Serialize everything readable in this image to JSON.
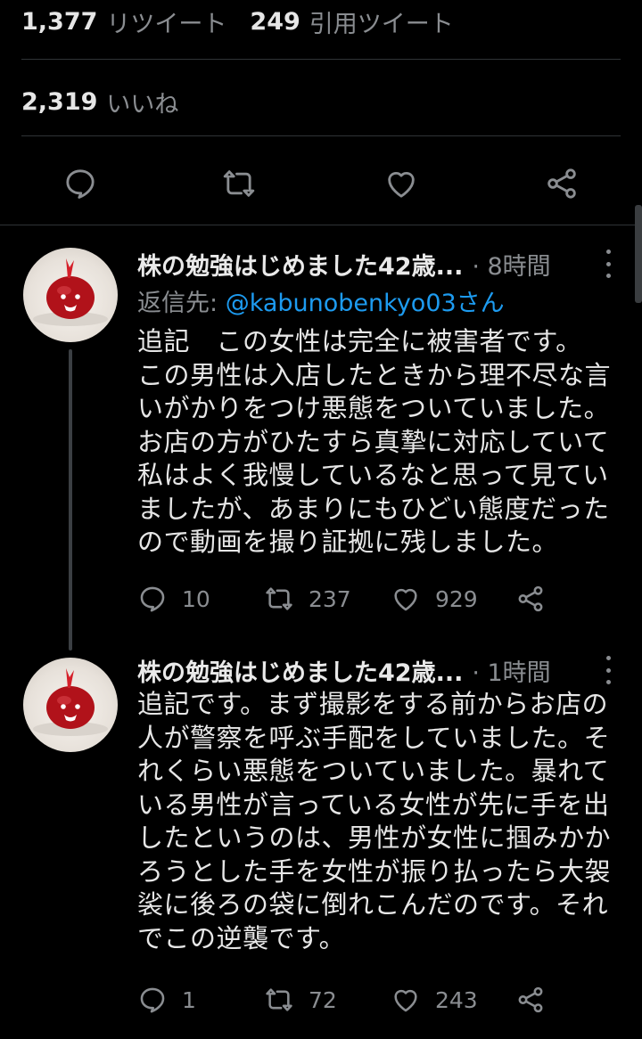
{
  "stats": {
    "retweets_count": "1,377",
    "retweets_label": "リツイート",
    "quotes_count": "249",
    "quotes_label": "引用ツイート",
    "likes_count": "2,319",
    "likes_label": "いいね"
  },
  "action_bar_icons": [
    "reply-icon",
    "retweet-icon",
    "like-icon",
    "share-icon"
  ],
  "tweets": [
    {
      "author": "株の勉強はじめました42歳...",
      "time": "· 8時間",
      "reply_label": "返信先:",
      "reply_handle": "@kabunobenkyo03さん",
      "lines": [
        "追記　この女性は完全に被害者です。",
        "この男性は入店したときから理不尽な言",
        "いがかりをつけ悪態をついていました。",
        "お店の方がひたすら真摯に対応していて",
        "私はよく我慢しているなと思って見てい",
        "ましたが、あまりにもひどい態度だった",
        "ので動画を撮り証拠に残しました。"
      ],
      "replies": "10",
      "retweets": "237",
      "likes": "929"
    },
    {
      "author": "株の勉強はじめました42歳...",
      "time": "· 1時間",
      "lines": [
        "追記です。まず撮影をする前からお店の",
        "人が警察を呼ぶ手配をしていました。そ",
        "れくらい悪態をついていました。暴れて",
        "いる男性が言っている女性が先に手を出",
        "したというのは、男性が女性に掴みかか",
        "ろうとした手を女性が振り払ったら大袈",
        "裟に後ろの袋に倒れこんだのです。それ",
        "でこの逆襲です。"
      ],
      "replies": "1",
      "retweets": "72",
      "likes": "243"
    }
  ],
  "colors": {
    "background": "#000000",
    "text": "#e6e6e6",
    "muted": "#8a8d91",
    "link": "#1d9bf0",
    "divider": "#2f3336"
  }
}
